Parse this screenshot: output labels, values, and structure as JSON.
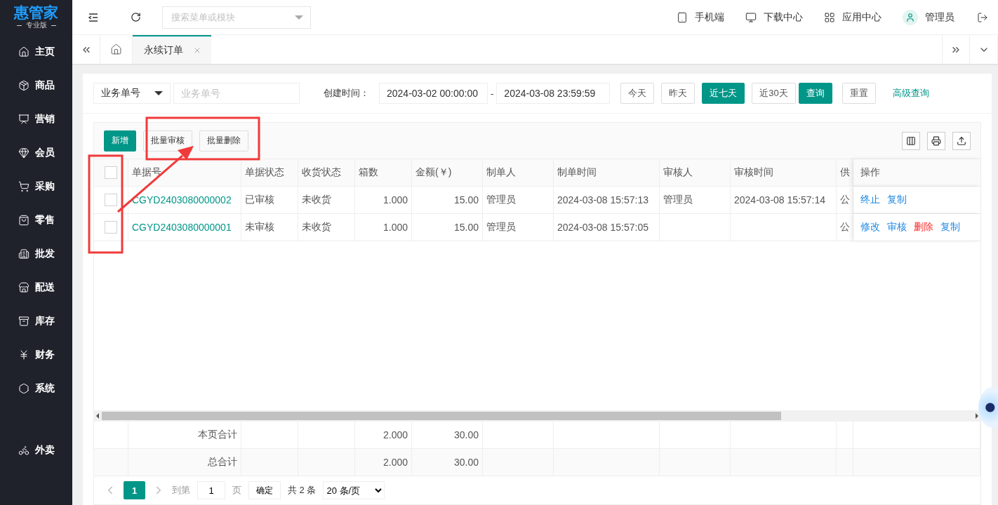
{
  "brand": {
    "name": "惠管家",
    "edition": "专业版"
  },
  "sidebar": [
    {
      "label": "主页"
    },
    {
      "label": "商品"
    },
    {
      "label": "营销"
    },
    {
      "label": "会员"
    },
    {
      "label": "采购"
    },
    {
      "label": "零售"
    },
    {
      "label": "批发"
    },
    {
      "label": "配送"
    },
    {
      "label": "库存"
    },
    {
      "label": "财务"
    },
    {
      "label": "系统"
    },
    {
      "label": "外卖"
    }
  ],
  "search": {
    "placeholder": "搜索菜单或模块"
  },
  "header_links": [
    "手机端",
    "下载中心",
    "应用中心"
  ],
  "user": "管理员",
  "tabs": [
    {
      "label": "永续订单",
      "selected": true
    }
  ],
  "filter": {
    "field_select": "业务单号",
    "field_placeholder": "业务单号",
    "date_label": "创建时间：",
    "date_from": "2024-03-02 00:00:00",
    "date_separator": "-",
    "date_to": "2024-03-08 23:59:59",
    "quick_ranges": [
      {
        "label": "今天",
        "selected": false
      },
      {
        "label": "昨天",
        "selected": false
      },
      {
        "label": "近七天",
        "selected": true
      },
      {
        "label": "近30天",
        "selected": false
      }
    ],
    "query": "查询",
    "reset": "重置",
    "advanced": "高级查询"
  },
  "toolbar": [
    {
      "label": "新增",
      "kind": "primary"
    },
    {
      "label": "批量审核",
      "kind": "default"
    },
    {
      "label": "批量删除",
      "kind": "default"
    }
  ],
  "table": {
    "header_checked": false,
    "columns": [
      "单据号",
      "单据状态",
      "收货状态",
      "箱数",
      "金额(￥)",
      "制单人",
      "制单时间",
      "审核人",
      "审核时间",
      "供",
      "操作"
    ],
    "rows": [
      {
        "checked": false,
        "cells": [
          "CGYD2403080000002",
          "已审核",
          "未收货",
          "1.000",
          "15.00",
          "管理员",
          "2024-03-08 15:57:13",
          "管理员",
          "2024-03-08 15:57:14",
          "公"
        ],
        "actions": [
          {
            "label": "终止",
            "kind": "link"
          },
          {
            "label": "复制",
            "kind": "link"
          }
        ]
      },
      {
        "checked": false,
        "cells": [
          "CGYD2403080000001",
          "未审核",
          "未收货",
          "1.000",
          "15.00",
          "管理员",
          "2024-03-08 15:57:05",
          "",
          "",
          "公"
        ],
        "actions": [
          {
            "label": "修改",
            "kind": "link"
          },
          {
            "label": "审核",
            "kind": "link"
          },
          {
            "label": "删除",
            "kind": "danger"
          },
          {
            "label": "复制",
            "kind": "link"
          }
        ]
      }
    ],
    "totals": [
      {
        "label": "本页合计",
        "boxes": "2.000",
        "amount": "30.00"
      },
      {
        "label": "总合计",
        "boxes": "2.000",
        "amount": "30.00"
      }
    ]
  },
  "pagination": {
    "pages": [
      {
        "label": "1",
        "selected": true
      }
    ],
    "goto_label": "到第",
    "goto_value": "1",
    "page_unit": "页",
    "confirm": "确定",
    "total": "共 2 条",
    "page_size": "20 条/页"
  }
}
